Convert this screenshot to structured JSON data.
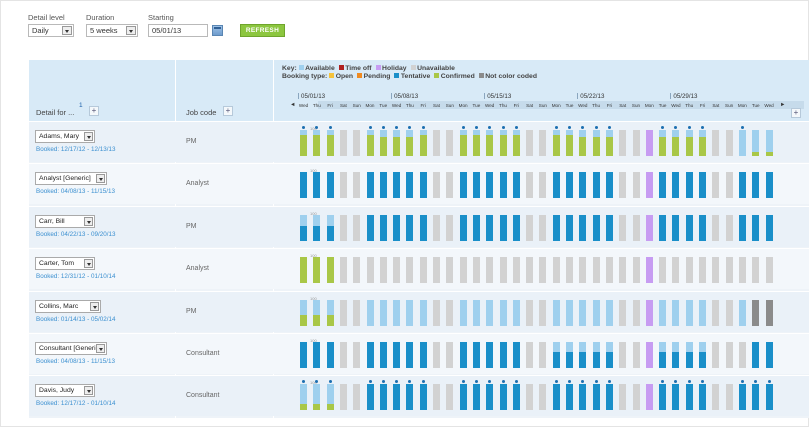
{
  "toolbar": {
    "detail_label": "Detail level",
    "detail_value": "Daily",
    "duration_label": "Duration",
    "duration_value": "5 weeks",
    "starting_label": "Starting",
    "starting_value": "05/01/13",
    "refresh_label": "REFRESH"
  },
  "header": {
    "detail_for": "Detail for ...",
    "sort_order": "1",
    "job_code": "Job code",
    "add_symbol": "+",
    "key_label": "Key:",
    "booking_type_label": "Booking type:",
    "key_items": [
      {
        "label": "Available",
        "color": "#9fd0ee"
      },
      {
        "label": "Time off",
        "color": "#b02020"
      },
      {
        "label": "Holiday",
        "color": "#c79cf2"
      },
      {
        "label": "Unavailable",
        "color": "#d2d2d2"
      }
    ],
    "booking_items": [
      {
        "label": "Open",
        "color": "#f4c23b"
      },
      {
        "label": "Pending",
        "color": "#f08a20"
      },
      {
        "label": "Tentative",
        "color": "#1a8fc9"
      },
      {
        "label": "Confirmed",
        "color": "#a9c747"
      },
      {
        "label": "Not color coded",
        "color": "#8b8b8b"
      }
    ],
    "weeks": [
      "05/01/13",
      "05/08/13",
      "05/15/13",
      "05/22/13",
      "05/29/13"
    ],
    "day_names": [
      "Wed",
      "Thu",
      "Fri",
      "Sat",
      "Sun",
      "Mon",
      "Tue"
    ],
    "prev_arrow": "◄",
    "next_arrow": "►",
    "axis_max": "100"
  },
  "colors": {
    "available": "#9fd0ee",
    "tentative": "#1a8fc9",
    "confirmed": "#a9c747",
    "unavailable": "#d2d2d2",
    "holiday": "#c79cf2",
    "not_color_coded": "#8b8b8b",
    "link": "#3a8fd0"
  },
  "rows": [
    {
      "name": "Adams, Mary",
      "booked": "Booked: 12/17/12 - 12/13/13",
      "job": "PM",
      "pattern": "adams"
    },
    {
      "name": "Analyst [Generic]",
      "booked": "Booked: 04/08/13 - 11/15/13",
      "job": "Analyst",
      "pattern": "analyst"
    },
    {
      "name": "Carr, Bill",
      "booked": "Booked: 04/22/13 - 09/20/13",
      "job": "PM",
      "pattern": "carr"
    },
    {
      "name": "Carter, Tom",
      "booked": "Booked: 12/31/12 - 01/10/14",
      "job": "Analyst",
      "pattern": "carter"
    },
    {
      "name": "Collins, Marc",
      "booked": "Booked: 01/14/13 - 05/02/14",
      "job": "PM",
      "pattern": "collins"
    },
    {
      "name": "Consultant [Generic]",
      "booked": "Booked: 04/08/13 - 11/15/13",
      "job": "Consultant",
      "pattern": "consultant"
    },
    {
      "name": "Davis, Judy",
      "booked": "Booked: 12/17/12 - 01/10/14",
      "job": "Consultant",
      "pattern": "davis"
    }
  ]
}
